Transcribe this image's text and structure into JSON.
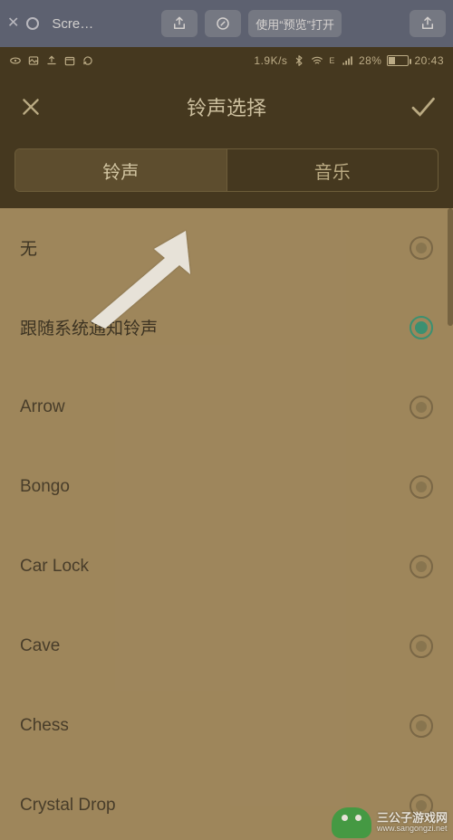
{
  "mac_bar": {
    "title": "Scre…",
    "open_with_label": "使用“预览”打开"
  },
  "status": {
    "speed": "1.9K/s",
    "network_label": "E",
    "battery_pct": "28%",
    "time": "20:43"
  },
  "header": {
    "title": "铃声选择"
  },
  "tabs": {
    "ringtone": "铃声",
    "music": "音乐"
  },
  "list": {
    "items": [
      {
        "label": "无",
        "selected": false,
        "inner": true
      },
      {
        "label": "跟随系统通知铃声",
        "selected": true,
        "inner": false
      },
      {
        "label": "Arrow",
        "selected": false,
        "inner": true
      },
      {
        "label": "Bongo",
        "selected": false,
        "inner": true
      },
      {
        "label": "Car Lock",
        "selected": false,
        "inner": true
      },
      {
        "label": "Cave",
        "selected": false,
        "inner": true
      },
      {
        "label": "Chess",
        "selected": false,
        "inner": true
      },
      {
        "label": "Crystal Drop",
        "selected": false,
        "inner": true
      }
    ]
  },
  "watermark": {
    "cn": "三公子游戏网",
    "domain": "www.sangongzi.net"
  },
  "colors": {
    "mac_bar": "#576280",
    "header_bg": "#3a301e",
    "list_bg": "#a68f67",
    "accent_selected": "#2e9c82"
  }
}
